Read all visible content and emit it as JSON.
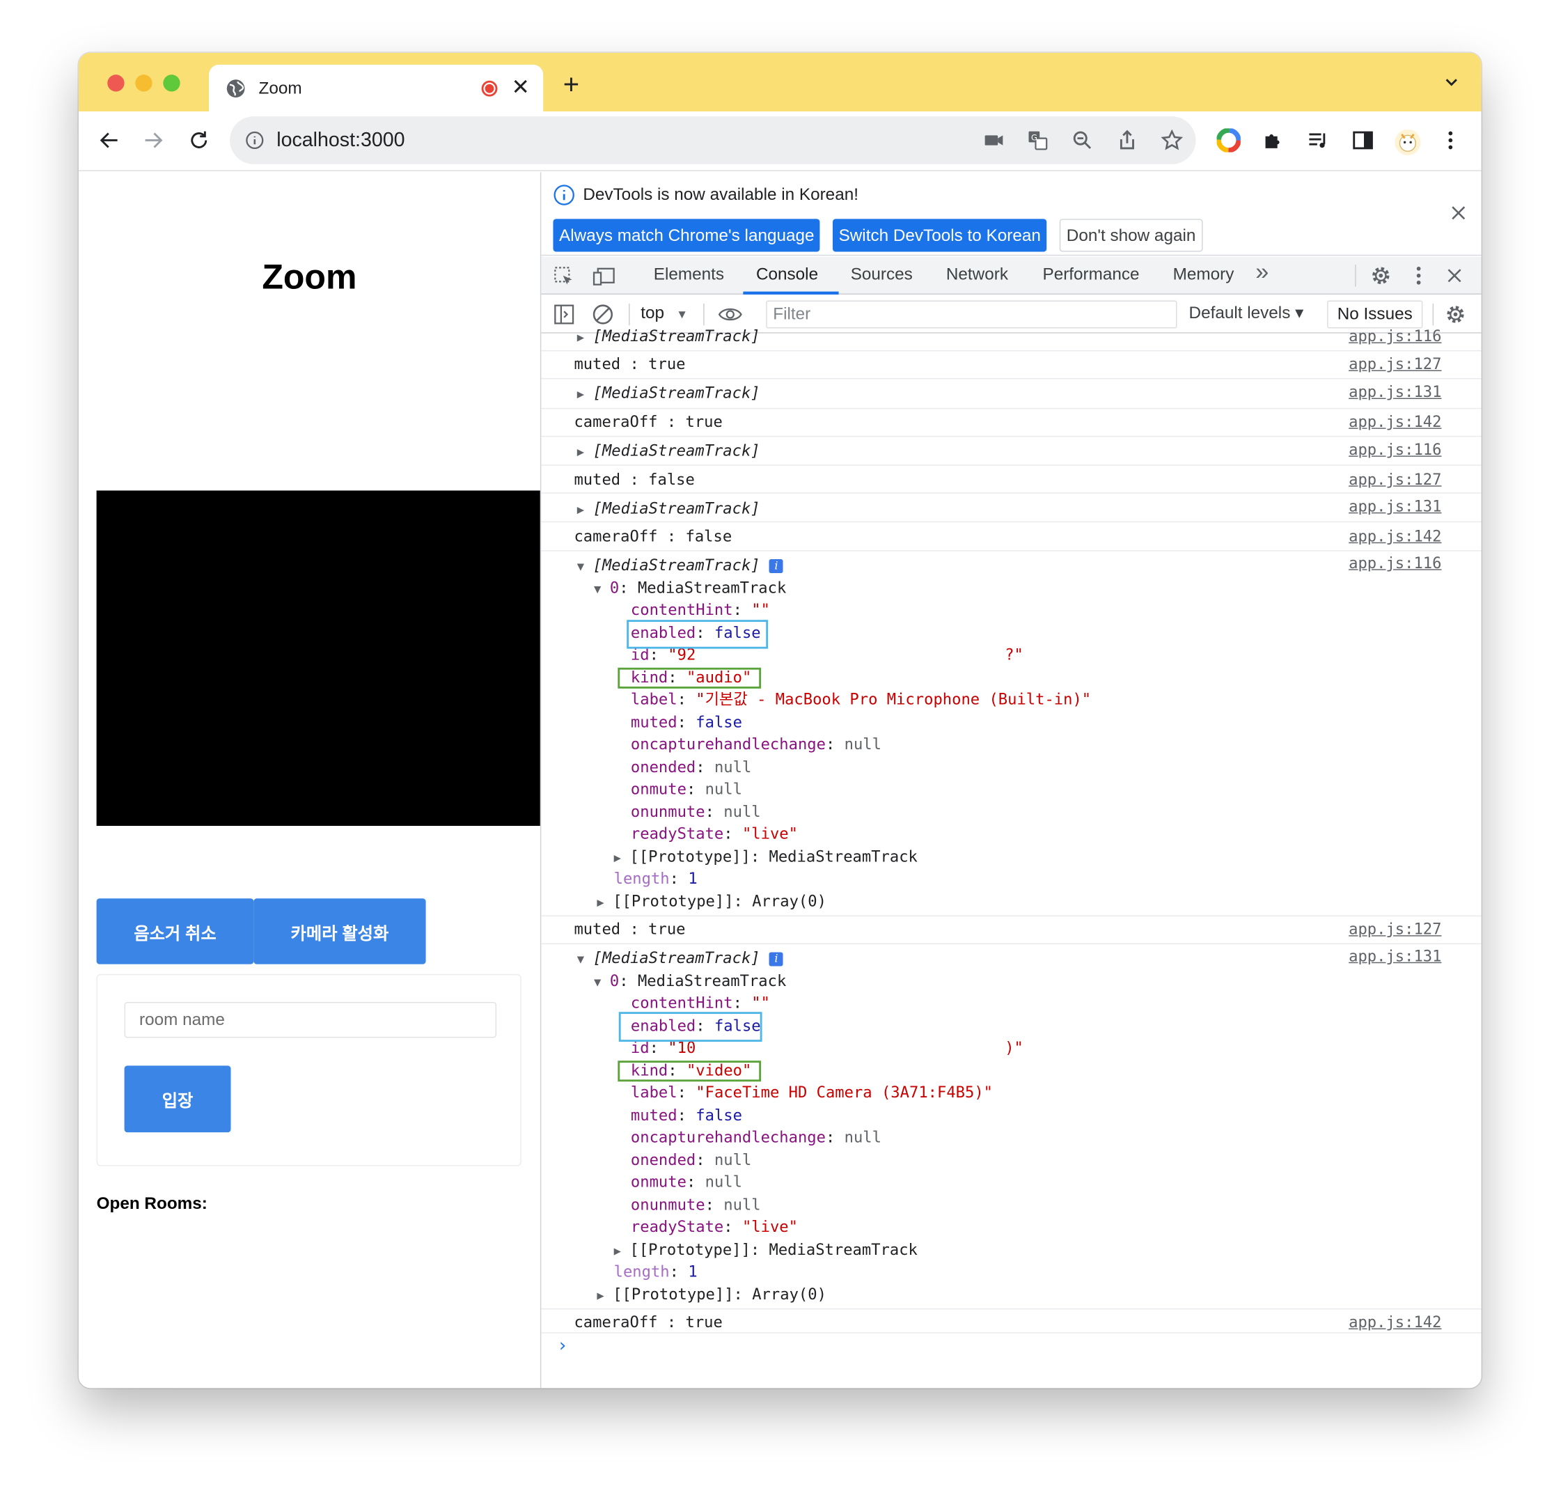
{
  "browser": {
    "tab_title": "Zoom",
    "tab_close": "✕",
    "new_tab": "+",
    "url": "localhost:3000"
  },
  "page": {
    "title": "Zoom",
    "mute_button": "음소거 취소",
    "camera_button": "카메라 활성화",
    "room_placeholder": "room name",
    "enter_button": "입장",
    "open_rooms": "Open Rooms:"
  },
  "devtools": {
    "info_message": "DevTools is now available in Korean!",
    "btn_match": "Always match Chrome's language",
    "btn_switch": "Switch DevTools to Korean",
    "btn_dont_show": "Don't show again",
    "tabs": [
      "Elements",
      "Console",
      "Sources",
      "Network",
      "Performance",
      "Memory"
    ],
    "more_tabs": "»",
    "context": "top",
    "filter_placeholder": "Filter",
    "levels": "Default levels ▾",
    "issues": "No Issues"
  },
  "console": {
    "partial_top": {
      "text": "[MediaStreamTrack]",
      "src": "app.js:116"
    },
    "log1": {
      "key": "muted",
      "value": "true",
      "src": "app.js:127"
    },
    "log2": {
      "text": "[MediaStreamTrack]",
      "src": "app.js:131"
    },
    "log3": {
      "key": "cameraOff",
      "value": "true",
      "src": "app.js:142"
    },
    "log4": {
      "text": "[MediaStreamTrack]",
      "src": "app.js:116"
    },
    "log5": {
      "key": "muted",
      "value": "false",
      "src": "app.js:127"
    },
    "log6": {
      "text": "[MediaStreamTrack]",
      "src": "app.js:131"
    },
    "log7": {
      "key": "cameraOff",
      "value": "false",
      "src": "app.js:142"
    },
    "audio": {
      "header": "[MediaStreamTrack]",
      "src": "app.js:116",
      "item": "MediaStreamTrack",
      "contentHint": "\"\"",
      "enabled": "false",
      "id": "\"92",
      "id_tail": "?\"",
      "kind": "\"audio\"",
      "label": "\"기본값 - MacBook Pro Microphone (Built-in)\"",
      "muted": "false",
      "oncapturehandlechange": "null",
      "onended": "null",
      "onmute": "null",
      "onunmute": "null",
      "readyState": "\"live\"",
      "proto": "MediaStreamTrack",
      "length": "1",
      "array_proto": "Array(0)"
    },
    "log8": {
      "key": "muted",
      "value": "true",
      "src": "app.js:127"
    },
    "video": {
      "header": "[MediaStreamTrack]",
      "src": "app.js:131",
      "item": "MediaStreamTrack",
      "contentHint": "\"\"",
      "enabled": "false",
      "id": "\"10",
      "id_tail": ")\"",
      "kind": "\"video\"",
      "label": "\"FaceTime HD Camera (3A71:F4B5)\"",
      "muted": "false",
      "oncapturehandlechange": "null",
      "onended": "null",
      "onmute": "null",
      "onunmute": "null",
      "readyState": "\"live\"",
      "proto": "MediaStreamTrack",
      "length": "1",
      "array_proto": "Array(0)"
    },
    "log9": {
      "key": "cameraOff",
      "value": "true",
      "src": "app.js:142"
    },
    "prompt": "›"
  }
}
